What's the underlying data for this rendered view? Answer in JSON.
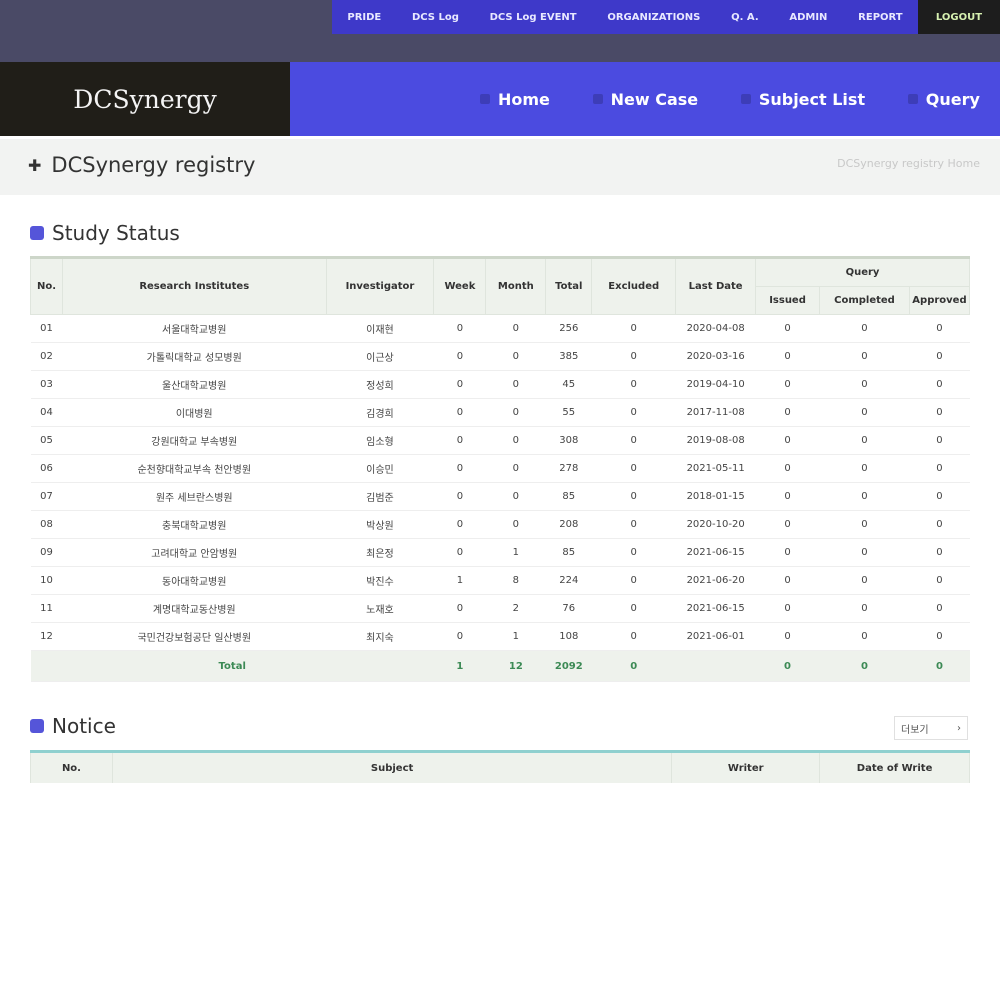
{
  "toplinks": [
    "PRIDE",
    "DCS Log",
    "DCS Log EVENT",
    "ORGANIZATIONS",
    "Q. A.",
    "ADMIN",
    "REPORT"
  ],
  "logout": "LOGOUT",
  "brand": "DCSynergy",
  "nav": [
    "Home",
    "New Case",
    "Subject List",
    "Query"
  ],
  "page_title": "DCSynergy registry",
  "breadcrumb": "DCSynergy registry Home",
  "study_status": {
    "title": "Study Status",
    "headers": {
      "no": "No.",
      "institution": "Research Institutes",
      "investigator": "Investigator",
      "week": "Week",
      "month": "Month",
      "total": "Total",
      "excluded": "Excluded",
      "last_date": "Last Date",
      "query": "Query",
      "issued": "Issued",
      "completed": "Completed",
      "approved": "Approved"
    },
    "rows": [
      [
        "01",
        "서울대학교병원",
        "이재현",
        "0",
        "0",
        "256",
        "0",
        "2020-04-08",
        "0",
        "0",
        "0"
      ],
      [
        "02",
        "가톨릭대학교 성모병원",
        "이근상",
        "0",
        "0",
        "385",
        "0",
        "2020-03-16",
        "0",
        "0",
        "0"
      ],
      [
        "03",
        "울산대학교병원",
        "정성희",
        "0",
        "0",
        "45",
        "0",
        "2019-04-10",
        "0",
        "0",
        "0"
      ],
      [
        "04",
        "이대병원",
        "김경희",
        "0",
        "0",
        "55",
        "0",
        "2017-11-08",
        "0",
        "0",
        "0"
      ],
      [
        "05",
        "강원대학교 부속병원",
        "임소형",
        "0",
        "0",
        "308",
        "0",
        "2019-08-08",
        "0",
        "0",
        "0"
      ],
      [
        "06",
        "순천향대학교부속 천안병원",
        "이승민",
        "0",
        "0",
        "278",
        "0",
        "2021-05-11",
        "0",
        "0",
        "0"
      ],
      [
        "07",
        "원주 세브란스병원",
        "김범준",
        "0",
        "0",
        "85",
        "0",
        "2018-01-15",
        "0",
        "0",
        "0"
      ],
      [
        "08",
        "충북대학교병원",
        "박상원",
        "0",
        "0",
        "208",
        "0",
        "2020-10-20",
        "0",
        "0",
        "0"
      ],
      [
        "09",
        "고려대학교 안암병원",
        "최은정",
        "0",
        "1",
        "85",
        "0",
        "2021-06-15",
        "0",
        "0",
        "0"
      ],
      [
        "10",
        "동아대학교병원",
        "박진수",
        "1",
        "8",
        "224",
        "0",
        "2021-06-20",
        "0",
        "0",
        "0"
      ],
      [
        "11",
        "계명대학교동산병원",
        "노재호",
        "0",
        "2",
        "76",
        "0",
        "2021-06-15",
        "0",
        "0",
        "0"
      ],
      [
        "12",
        "국민건강보험공단 일산병원",
        "최지숙",
        "0",
        "1",
        "108",
        "0",
        "2021-06-01",
        "0",
        "0",
        "0"
      ]
    ],
    "total": {
      "label": "Total",
      "week": "1",
      "month": "12",
      "total": "2092",
      "excluded": "0",
      "issued": "0",
      "completed": "0",
      "approved": "0"
    }
  },
  "notice": {
    "title": "Notice",
    "pager": "더보기",
    "pager_arrow": "›",
    "headers": {
      "no": "No.",
      "subject": "Subject",
      "writer": "Writer",
      "date": "Date of Write"
    }
  }
}
